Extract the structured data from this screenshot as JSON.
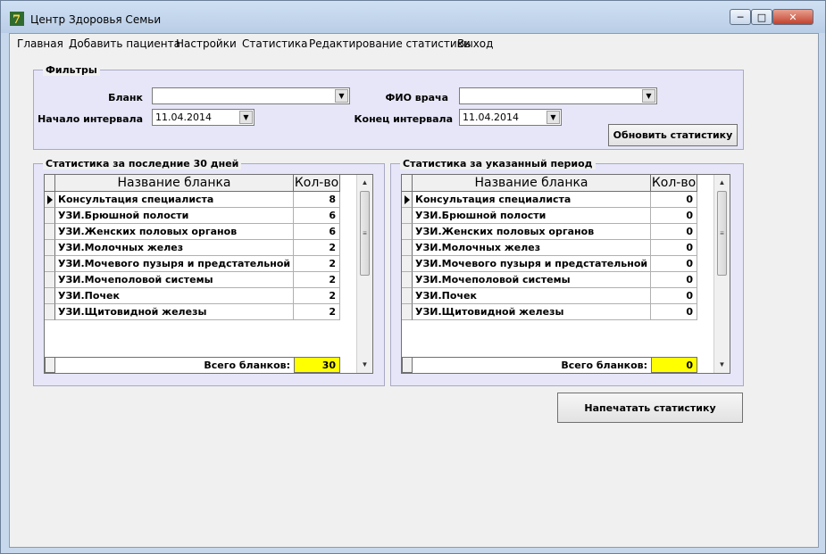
{
  "window": {
    "title": "Центр Здоровья Семьи"
  },
  "menu": [
    {
      "label": "Главная"
    },
    {
      "label": "Добавить пациента"
    },
    {
      "label": "Настройки"
    },
    {
      "label": "Статистика"
    },
    {
      "label": "Редактирование статистики"
    },
    {
      "label": "Выход"
    }
  ],
  "filters": {
    "title": "Фильтры",
    "blank_label": "Бланк",
    "blank_value": "",
    "doctor_label": "ФИО врача",
    "doctor_value": "",
    "start_label": "Начало интервала",
    "start_value": "11.04.2014",
    "end_label": "Конец интервала",
    "end_value": "11.04.2014",
    "refresh_label": "Обновить статистику"
  },
  "stats_last30": {
    "title": "Статистика за последние 30 дней",
    "col_name": "Название бланка",
    "col_count": "Кол-во",
    "rows": [
      {
        "name": "Консультация специалиста",
        "count": "8"
      },
      {
        "name": "УЗИ.Брюшной полости",
        "count": "6"
      },
      {
        "name": "УЗИ.Женских половых органов",
        "count": "6"
      },
      {
        "name": "УЗИ.Молочных желез",
        "count": "2"
      },
      {
        "name": "УЗИ.Мочевого пузыря и предстательной же",
        "count": "2"
      },
      {
        "name": "УЗИ.Мочеполовой системы",
        "count": "2"
      },
      {
        "name": "УЗИ.Почек",
        "count": "2"
      },
      {
        "name": "УЗИ.Щитовидной железы",
        "count": "2"
      }
    ],
    "total_label": "Всего бланков:",
    "total_value": "30"
  },
  "stats_period": {
    "title": "Статистика за указанный период",
    "col_name": "Название бланка",
    "col_count": "Кол-во",
    "rows": [
      {
        "name": "Консультация специалиста",
        "count": "0"
      },
      {
        "name": "УЗИ.Брюшной полости",
        "count": "0"
      },
      {
        "name": "УЗИ.Женских половых органов",
        "count": "0"
      },
      {
        "name": "УЗИ.Молочных желез",
        "count": "0"
      },
      {
        "name": "УЗИ.Мочевого пузыря и предстательной же",
        "count": "0"
      },
      {
        "name": "УЗИ.Мочеполовой системы",
        "count": "0"
      },
      {
        "name": "УЗИ.Почек",
        "count": "0"
      },
      {
        "name": "УЗИ.Щитовидной железы",
        "count": "0"
      }
    ],
    "total_label": "Всего бланков:",
    "total_value": "0"
  },
  "print_label": "Напечатать статистику",
  "colors": {
    "total_highlight": "#ffff00",
    "group_bg": "#e6e6f8"
  },
  "icons": {
    "app": "app-logo-icon",
    "minimize": "minimize-icon",
    "maximize": "maximize-icon",
    "close": "close-icon",
    "dropdown": "chevron-down-icon",
    "row_pointer": "row-pointer-icon"
  }
}
